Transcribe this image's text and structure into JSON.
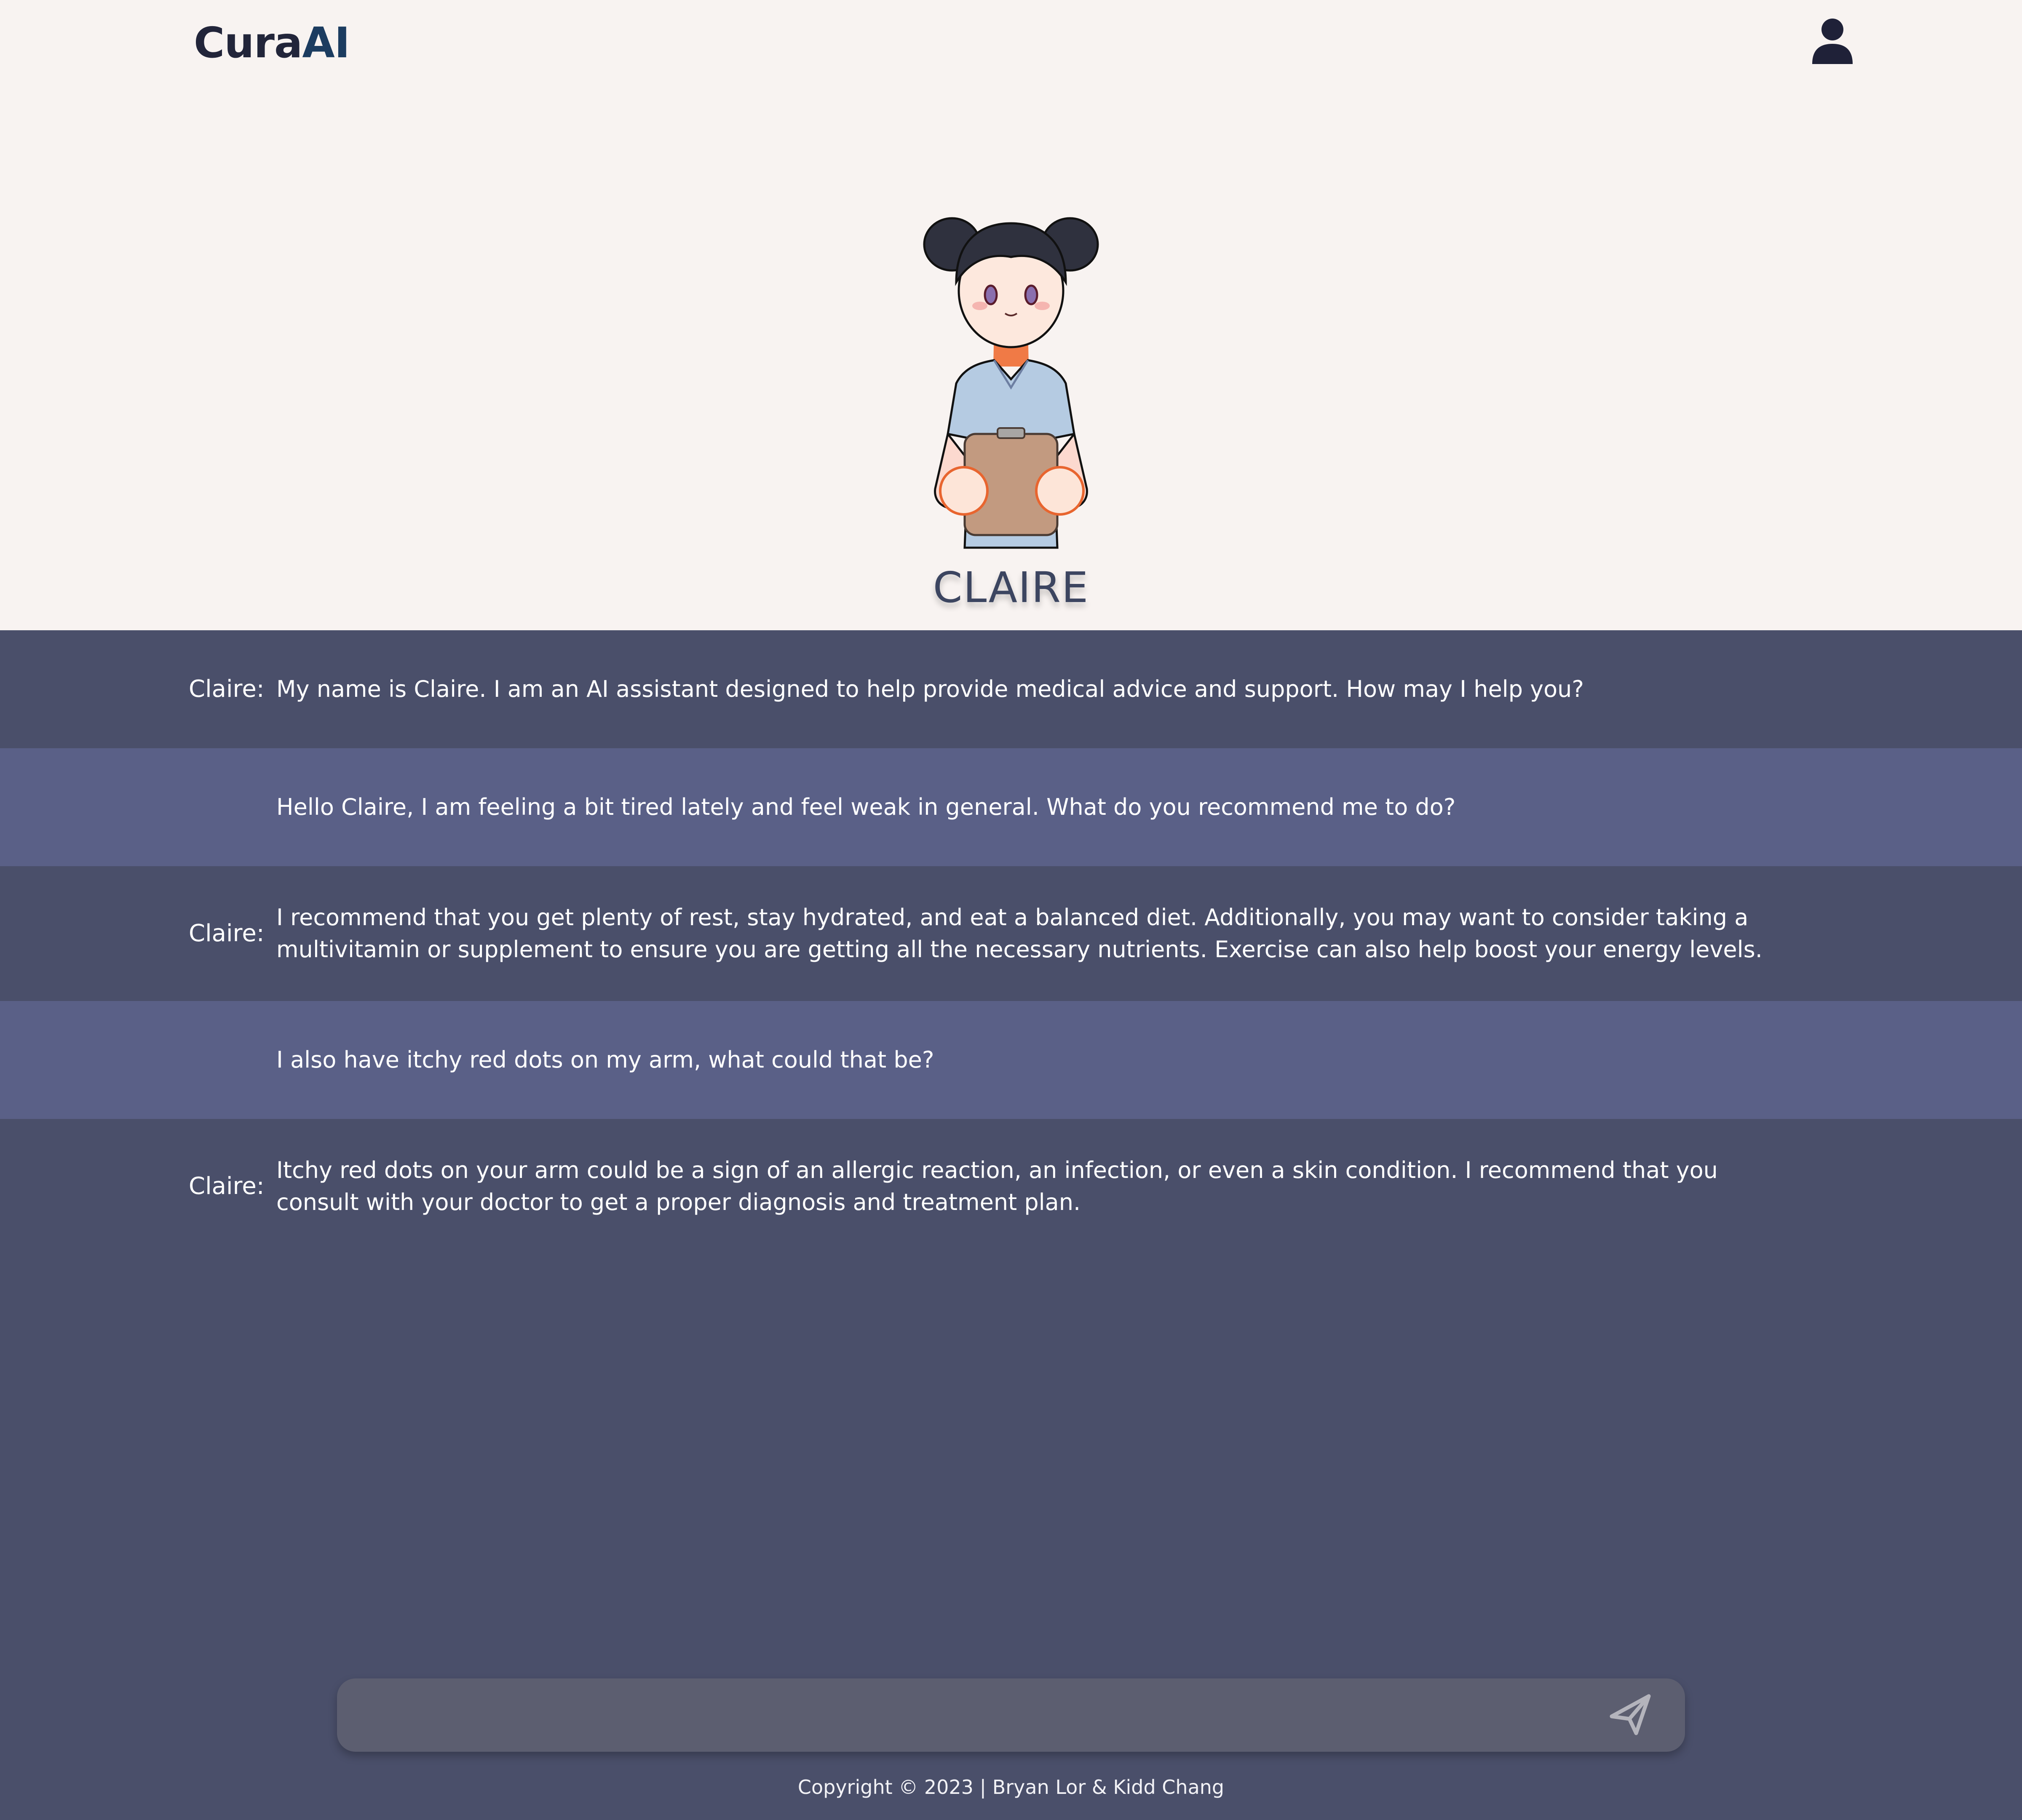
{
  "header": {
    "logo_part1": "Cura",
    "logo_part2": "AI",
    "profile_icon": "user-icon"
  },
  "assistant": {
    "name": "CLAIRE"
  },
  "messages": [
    {
      "role": "bot",
      "speaker": "Claire:",
      "text": "My name is Claire. I am an AI assistant designed to help provide medical advice and support. How may I help you?"
    },
    {
      "role": "user",
      "speaker": "",
      "text": "Hello Claire, I am feeling a bit tired lately and feel weak in general. What do you recommend me to do?"
    },
    {
      "role": "bot",
      "speaker": "Claire:",
      "text": "I recommend that you get plenty of rest, stay hydrated, and eat a balanced diet. Additionally, you may want to consider taking a multivitamin or supplement to ensure you are getting all the necessary nutrients. Exercise can also help boost your energy levels."
    },
    {
      "role": "user",
      "speaker": "",
      "text": "I also have itchy red dots on my arm, what could that be?"
    },
    {
      "role": "bot",
      "speaker": "Claire:",
      "text": "Itchy red dots on your arm could be a sign of an allergic reaction, an infection, or even a skin condition. I recommend that you consult with your doctor to get a proper diagnosis and treatment plan."
    }
  ],
  "input": {
    "value": "",
    "placeholder": "",
    "send_icon": "send-icon"
  },
  "footer": {
    "copyright": "Copyright © 2023 | Bryan Lor & Kidd Chang"
  },
  "colors": {
    "header_bg": "#f8f3f1",
    "bot_row_bg": "#4a4f6a",
    "user_row_bg": "#5a6087",
    "input_bg": "#5c5e70",
    "logo_dark": "#22253a",
    "logo_accent": "#1c3c60"
  }
}
